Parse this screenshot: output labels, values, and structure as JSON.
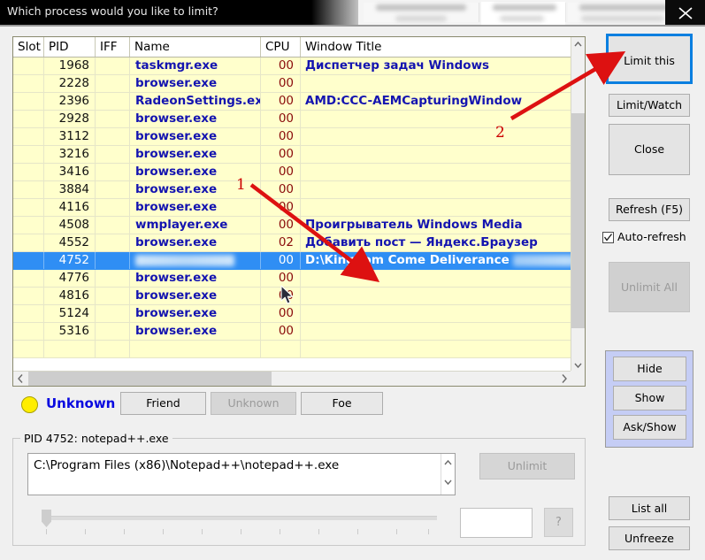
{
  "window": {
    "title": "Which process would you like to limit?",
    "close_icon": "close-x-icon"
  },
  "listview": {
    "columns": [
      "Slot",
      "PID",
      "IFF",
      "Name",
      "CPU",
      "Window Title"
    ],
    "rows": [
      {
        "slot": "",
        "pid": "1968",
        "iff": "",
        "name": "taskmgr.exe",
        "cpu": "00",
        "title": "Диспетчер задач Windows",
        "selected": false,
        "blurred_name": false,
        "blurred_title": false
      },
      {
        "slot": "",
        "pid": "2228",
        "iff": "",
        "name": "browser.exe",
        "cpu": "00",
        "title": "",
        "selected": false,
        "blurred_name": false,
        "blurred_title": false
      },
      {
        "slot": "",
        "pid": "2396",
        "iff": "",
        "name": "RadeonSettings.exe",
        "cpu": "00",
        "title": "AMD:CCC-AEMCapturingWindow",
        "selected": false,
        "blurred_name": false,
        "blurred_title": false
      },
      {
        "slot": "",
        "pid": "2928",
        "iff": "",
        "name": "browser.exe",
        "cpu": "00",
        "title": "",
        "selected": false,
        "blurred_name": false,
        "blurred_title": false
      },
      {
        "slot": "",
        "pid": "3112",
        "iff": "",
        "name": "browser.exe",
        "cpu": "00",
        "title": "",
        "selected": false,
        "blurred_name": false,
        "blurred_title": false
      },
      {
        "slot": "",
        "pid": "3216",
        "iff": "",
        "name": "browser.exe",
        "cpu": "00",
        "title": "",
        "selected": false,
        "blurred_name": false,
        "blurred_title": false
      },
      {
        "slot": "",
        "pid": "3416",
        "iff": "",
        "name": "browser.exe",
        "cpu": "00",
        "title": "",
        "selected": false,
        "blurred_name": false,
        "blurred_title": false
      },
      {
        "slot": "",
        "pid": "3884",
        "iff": "",
        "name": "browser.exe",
        "cpu": "00",
        "title": "",
        "selected": false,
        "blurred_name": false,
        "blurred_title": false
      },
      {
        "slot": "",
        "pid": "4116",
        "iff": "",
        "name": "browser.exe",
        "cpu": "00",
        "title": "",
        "selected": false,
        "blurred_name": false,
        "blurred_title": false
      },
      {
        "slot": "",
        "pid": "4508",
        "iff": "",
        "name": "wmplayer.exe",
        "cpu": "00",
        "title": "Проигрыватель Windows Media",
        "selected": false,
        "blurred_name": false,
        "blurred_title": false
      },
      {
        "slot": "",
        "pid": "4552",
        "iff": "",
        "name": "browser.exe",
        "cpu": "02",
        "title": "Добавить пост — Яндекс.Браузер",
        "selected": false,
        "blurred_name": false,
        "blurred_title": false
      },
      {
        "slot": "",
        "pid": "4752",
        "iff": "",
        "name": "",
        "cpu": "00",
        "title": "D:\\Kingdom Come Deliverance",
        "selected": true,
        "blurred_name": true,
        "blurred_title": true
      },
      {
        "slot": "",
        "pid": "4776",
        "iff": "",
        "name": "browser.exe",
        "cpu": "00",
        "title": "",
        "selected": false,
        "blurred_name": false,
        "blurred_title": false
      },
      {
        "slot": "",
        "pid": "4816",
        "iff": "",
        "name": "browser.exe",
        "cpu": "00",
        "title": "",
        "selected": false,
        "blurred_name": false,
        "blurred_title": false
      },
      {
        "slot": "",
        "pid": "5124",
        "iff": "",
        "name": "browser.exe",
        "cpu": "00",
        "title": "",
        "selected": false,
        "blurred_name": false,
        "blurred_title": false
      },
      {
        "slot": "",
        "pid": "5316",
        "iff": "",
        "name": "browser.exe",
        "cpu": "00",
        "title": "",
        "selected": false,
        "blurred_name": false,
        "blurred_title": false
      },
      {
        "slot": "",
        "pid": "",
        "iff": "",
        "name": "",
        "cpu": "",
        "title": "",
        "selected": false,
        "blurred_name": false,
        "blurred_title": false
      }
    ]
  },
  "iff": {
    "status_label": "Unknown",
    "status_color": "#ffee00",
    "friend_label": "Friend",
    "unknown_label": "Unknown",
    "foe_label": "Foe"
  },
  "details": {
    "group_label": "PID 4752: notepad++.exe",
    "path_value": "C:\\Program Files (x86)\\Notepad++\\notepad++.exe",
    "unlimit_label": "Unlimit",
    "value_input": "",
    "help_label": "?"
  },
  "actions": {
    "limit_this": "Limit this",
    "limit_watch": "Limit/Watch",
    "close": "Close",
    "refresh": "Refresh (F5)",
    "auto_refresh": "Auto-refresh",
    "auto_refresh_checked": true,
    "unlimit_all": "Unlimit All",
    "hide": "Hide",
    "show": "Show",
    "ask_show": "Ask/Show",
    "list_all": "List all",
    "unfreeze": "Unfreeze"
  },
  "annotations": {
    "accent": "#dd1111",
    "marker_1": "1",
    "marker_2": "2"
  }
}
